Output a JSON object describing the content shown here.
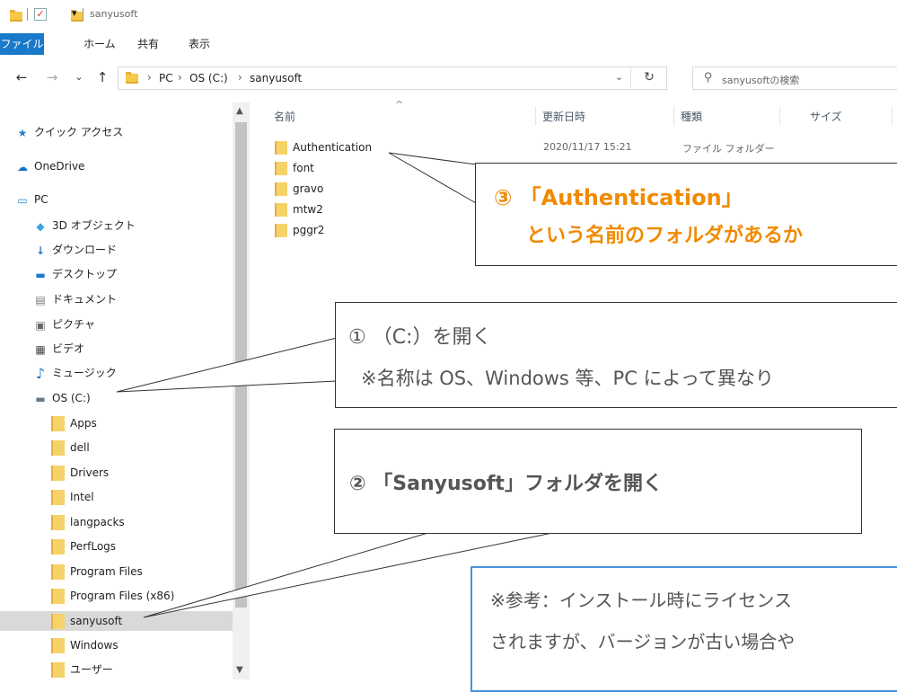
{
  "titlebar": {
    "title": "sanyusoft",
    "check_glyph": "✓",
    "dropdown_glyph": "▾"
  },
  "ribbon": {
    "tabs": [
      "ファイル",
      "ホーム",
      "共有",
      "表示"
    ]
  },
  "nav": {
    "back": "←",
    "forward": "→",
    "recent": "⌄",
    "up": "↑",
    "breadcrumb": [
      "PC",
      "OS (C:)",
      "sanyusoft"
    ],
    "sep": "›",
    "dropdown": "⌄",
    "refresh": "↻",
    "search_placeholder": "sanyusoftの検索",
    "search_icon": "⚲"
  },
  "sidebar": {
    "scroll_up": "▲",
    "scroll_down": "▼",
    "items": [
      {
        "label": "クイック アクセス",
        "icon": "star-icon",
        "glyph": "★"
      },
      {
        "label": "OneDrive",
        "icon": "cloud-icon",
        "glyph": "☁"
      },
      {
        "label": "PC",
        "icon": "pc-icon",
        "glyph": "▭"
      },
      {
        "label": "3D オブジェクト",
        "icon": "cube-icon",
        "glyph": "◆"
      },
      {
        "label": "ダウンロード",
        "icon": "download-icon",
        "glyph": "↓"
      },
      {
        "label": "デスクトップ",
        "icon": "desktop-icon",
        "glyph": "▬"
      },
      {
        "label": "ドキュメント",
        "icon": "document-icon",
        "glyph": "▤"
      },
      {
        "label": "ピクチャ",
        "icon": "picture-icon",
        "glyph": "▣"
      },
      {
        "label": "ビデオ",
        "icon": "video-icon",
        "glyph": "▦"
      },
      {
        "label": "ミュージック",
        "icon": "music-icon",
        "glyph": "♪"
      },
      {
        "label": "OS (C:)",
        "icon": "drive-icon",
        "glyph": "▬"
      }
    ],
    "drive_children": [
      "Apps",
      "dell",
      "Drivers",
      "Intel",
      "langpacks",
      "PerfLogs",
      "Program Files",
      "Program Files (x86)",
      "sanyusoft",
      "Windows",
      "ユーザー"
    ]
  },
  "filelist": {
    "columns": [
      "名前",
      "更新日時",
      "種類",
      "サイズ"
    ],
    "sort_caret": "^",
    "rows": [
      {
        "name": "Authentication",
        "modified": "2020/11/17 15:21",
        "type": "ファイル フォルダー"
      },
      {
        "name": "font"
      },
      {
        "name": "gravo"
      },
      {
        "name": "mtw2"
      },
      {
        "name": "pggr2"
      }
    ]
  },
  "callouts": {
    "c3": {
      "line1": "③ 「Authentication」",
      "line2": "という名前のフォルダがあるか"
    },
    "c1": {
      "line1": "① （C:）を開く",
      "line2": "※名称は OS、Windows 等、PC によって異なり"
    },
    "c2": {
      "line1": "② 「Sanyusoft」フォルダを開く"
    },
    "note": {
      "line1": "※参考：インストール時にライセンス",
      "line2": "されますが、バージョンが古い場合や"
    }
  },
  "colors": {
    "accent": "#1979ca",
    "highlight": "#f08a00",
    "note_border": "#4a90d9"
  }
}
